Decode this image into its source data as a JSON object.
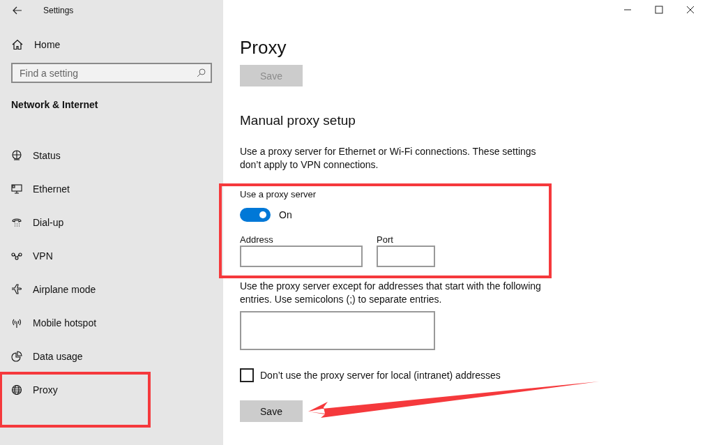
{
  "window": {
    "title": "Settings"
  },
  "sidebar": {
    "home": "Home",
    "search": {
      "placeholder": "Find a setting"
    },
    "section": "Network & Internet",
    "items": [
      {
        "label": "Status"
      },
      {
        "label": "Ethernet"
      },
      {
        "label": "Dial-up"
      },
      {
        "label": "VPN"
      },
      {
        "label": "Airplane mode"
      },
      {
        "label": "Mobile hotspot"
      },
      {
        "label": "Data usage"
      },
      {
        "label": "Proxy"
      }
    ]
  },
  "page": {
    "title": "Proxy",
    "top_button": {
      "label": "Save",
      "disabled": true
    },
    "heading": "Manual proxy setup",
    "description": "Use a proxy server for Ethernet or Wi-Fi connections. These settings don’t apply to VPN connections.",
    "toggle": {
      "label": "Use a proxy server",
      "on": true,
      "state_text": "On"
    },
    "address": {
      "label": "Address"
    },
    "port": {
      "label": "Port"
    },
    "exceptions": {
      "label": "Use the proxy server except for addresses that start with the following entries. Use semicolons (;) to separate entries."
    },
    "local_checkbox": {
      "label": "Don’t use the proxy server for local (intranet) addresses",
      "checked": false
    },
    "bottom_button": {
      "label": "Save",
      "disabled": false
    }
  }
}
